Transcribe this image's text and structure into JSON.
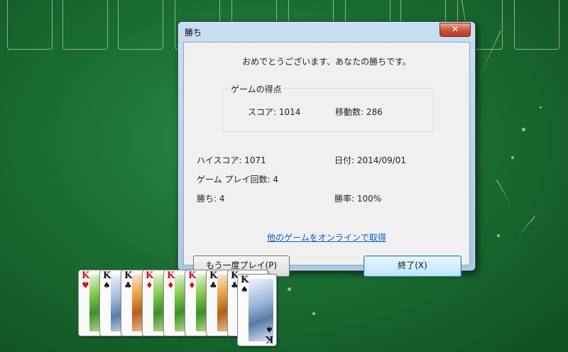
{
  "dialog": {
    "title": "勝ち",
    "close_label": "✕",
    "message": "おめでとうございます、あなたの勝ちです。",
    "game_score": {
      "legend": "ゲームの得点",
      "score_label": "スコア: 1014",
      "moves_label": "移動数: 286"
    },
    "stats": {
      "high_score": "ハイスコア: 1071",
      "date": "日付: 2014/09/01",
      "games_played": "ゲーム プレイ回数: 4",
      "wins": "勝ち: 4",
      "win_rate": "勝率: 100%"
    },
    "online_link": "他のゲームをオンラインで取得",
    "play_again_button": "もう一度プレイ(P)",
    "exit_button": "終了(X)"
  },
  "cards": [
    {
      "rank": "K",
      "suit": "♥",
      "color": "red",
      "art": "leaf-green"
    },
    {
      "rank": "K",
      "suit": "♠",
      "color": "black",
      "art": "frost-blue"
    },
    {
      "rank": "K",
      "suit": "♣",
      "color": "black",
      "art": "autumn-orange"
    },
    {
      "rank": "K",
      "suit": "♦",
      "color": "red",
      "art": "leaf-green"
    },
    {
      "rank": "K",
      "suit": "♦",
      "color": "red",
      "art": "leaf-green"
    },
    {
      "rank": "K",
      "suit": "♦",
      "color": "red",
      "art": "leaf-green"
    },
    {
      "rank": "K",
      "suit": "♣",
      "color": "black",
      "art": "autumn-orange"
    },
    {
      "rank": "K",
      "suit": "♣",
      "color": "black",
      "art": "autumn-orange"
    },
    {
      "rank": "K",
      "suit": "♠",
      "color": "black",
      "art": "frost-blue"
    }
  ],
  "colors": {
    "felt": "#1b6f33",
    "link": "#0a5ec8",
    "close_button": "#c8533a"
  }
}
